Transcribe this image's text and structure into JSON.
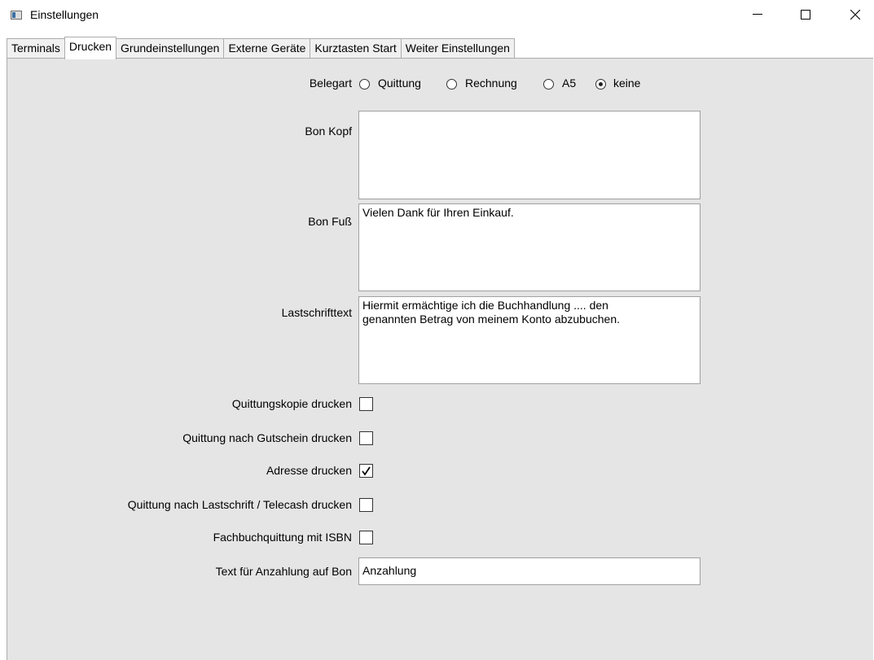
{
  "window": {
    "title": "Einstellungen"
  },
  "tabs": [
    {
      "label": "Terminals"
    },
    {
      "label": "Drucken"
    },
    {
      "label": "Grundeinstellungen"
    },
    {
      "label": "Externe Geräte"
    },
    {
      "label": "Kurztasten Start"
    },
    {
      "label": "Weiter Einstellungen"
    }
  ],
  "active_tab": "Drucken",
  "belegart": {
    "label": "Belegart",
    "options": [
      {
        "label": "Quittung",
        "checked": false
      },
      {
        "label": "Rechnung",
        "checked": false
      },
      {
        "label": "A5",
        "checked": false
      },
      {
        "label": "keine",
        "checked": true
      }
    ]
  },
  "bon_kopf": {
    "label": "Bon Kopf",
    "value": ""
  },
  "bon_fuss": {
    "label": "Bon Fuß",
    "value": "Vielen Dank für Ihren Einkauf."
  },
  "lastschrift": {
    "label": "Lastschrifttext",
    "value": "Hiermit ermächtige ich die Buchhandlung .... den\ngenannten Betrag von meinem Konto abzubuchen."
  },
  "checkboxes": [
    {
      "label": "Quittungskopie drucken",
      "checked": false
    },
    {
      "label": "Quittung nach Gutschein drucken",
      "checked": false
    },
    {
      "label": "Adresse drucken",
      "checked": true
    },
    {
      "label": "Quittung nach Lastschrift / Telecash drucken",
      "checked": false
    },
    {
      "label": "Fachbuchquittung mit ISBN",
      "checked": false
    }
  ],
  "anzahlung": {
    "label": "Text für Anzahlung auf Bon",
    "value": "Anzahlung"
  },
  "icons": {
    "app": "settings-window-icon",
    "minimize": "minimize-icon",
    "maximize": "maximize-icon",
    "close": "close-icon",
    "check": "checkmark-icon"
  }
}
